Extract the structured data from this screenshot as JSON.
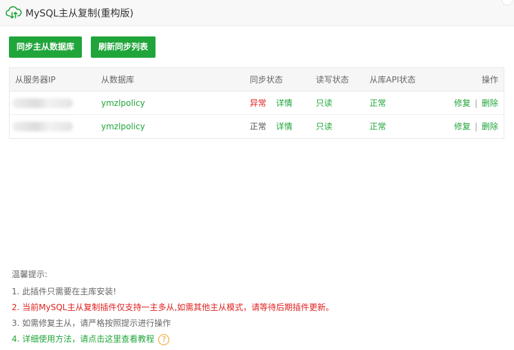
{
  "window": {
    "title": "MySQL主从复制(重构版)",
    "icon": "cloud-sync-icon",
    "accent_color": "#20a53a"
  },
  "toolbar": {
    "sync_label": "同步主从数据库",
    "refresh_label": "刷新同步列表"
  },
  "table": {
    "headers": {
      "ip": "从服务器IP",
      "db": "从数据库",
      "sync": "同步状态",
      "rw": "读写状态",
      "api": "从库API状态",
      "op": "操作"
    },
    "rows": [
      {
        "db": "ymzlpolicy",
        "sync": "异常",
        "detail": "详情",
        "rw": "只读",
        "api": "正常",
        "repair": "修复",
        "separator": "|",
        "delete": "删除"
      },
      {
        "db": "ymzlpolicy",
        "sync": "正常",
        "detail": "详情",
        "rw": "只读",
        "api": "正常",
        "repair": "修复",
        "separator": "|",
        "delete": "删除"
      }
    ]
  },
  "tips": {
    "title": "温馨提示:",
    "items": [
      "1. 此插件只需要在主库安装!",
      "2. 当前MySQL主从复制插件仅支持一主多从,如需其他主从模式，请等待后期插件更新。",
      "3. 如需修复主从，请严格按照提示进行操作",
      "4. 详细使用方法，请点击这里查看教程"
    ],
    "help_icon_glyph": "?"
  },
  "colors": {
    "error": "#e02020",
    "success": "#20a53a",
    "warning": "#f0a020"
  }
}
